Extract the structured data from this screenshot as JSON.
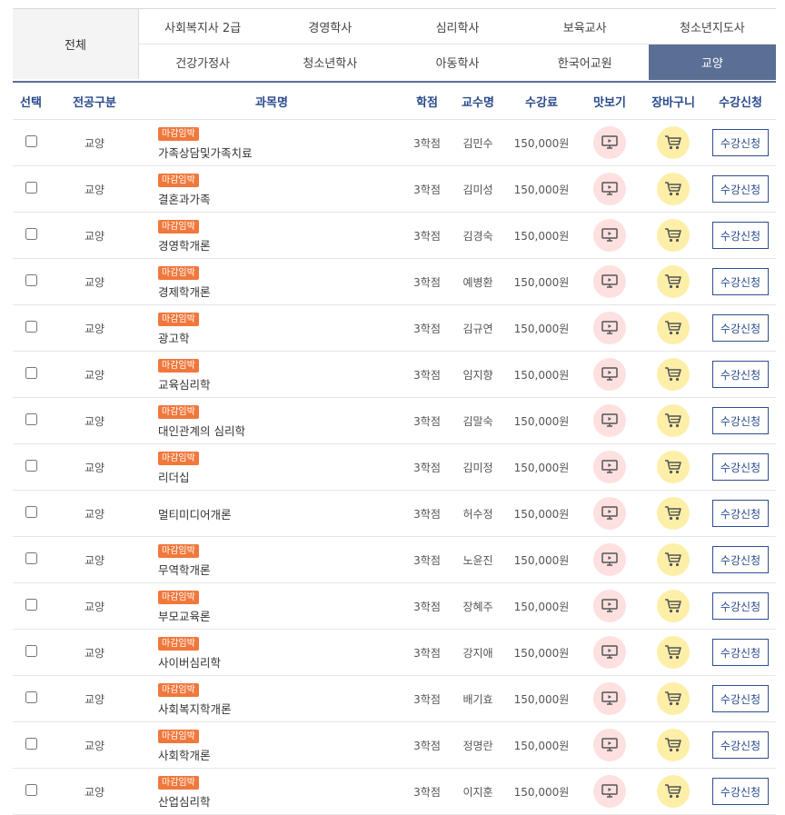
{
  "tabs": {
    "all": "전체",
    "row1": [
      "사회복지사 2급",
      "경영학사",
      "심리학사",
      "보육교사",
      "청소년지도사"
    ],
    "row2": [
      "건강가정사",
      "청소년학사",
      "아동학사",
      "한국어교원",
      "교양"
    ],
    "active": "교양"
  },
  "headers": {
    "select": "선택",
    "major": "전공구분",
    "course": "과목명",
    "credit": "학점",
    "professor": "교수명",
    "fee": "수강료",
    "preview": "맛보기",
    "cart": "장바구니",
    "apply": "수강신청"
  },
  "icons": {
    "preview": "monitor-icon",
    "cart": "cart-icon"
  },
  "colors": {
    "accent": "#5a6f94",
    "badge": "#f0783c",
    "preview_bg": "#fde0df",
    "cart_bg": "#fdefa8"
  },
  "rows": [
    {
      "major": "교양",
      "badge": "마감임박",
      "title": "가족상담및가족치료",
      "credit": "3학점",
      "professor": "김민수",
      "fee": "150,000원",
      "apply": "수강신청"
    },
    {
      "major": "교양",
      "badge": "마감임박",
      "title": "결혼과가족",
      "credit": "3학점",
      "professor": "김미성",
      "fee": "150,000원",
      "apply": "수강신청"
    },
    {
      "major": "교양",
      "badge": "마감임박",
      "title": "경영학개론",
      "credit": "3학점",
      "professor": "김경숙",
      "fee": "150,000원",
      "apply": "수강신청"
    },
    {
      "major": "교양",
      "badge": "마감임박",
      "title": "경제학개론",
      "credit": "3학점",
      "professor": "예병환",
      "fee": "150,000원",
      "apply": "수강신청"
    },
    {
      "major": "교양",
      "badge": "마감임박",
      "title": "광고학",
      "credit": "3학점",
      "professor": "김규연",
      "fee": "150,000원",
      "apply": "수강신청"
    },
    {
      "major": "교양",
      "badge": "마감임박",
      "title": "교육심리학",
      "credit": "3학점",
      "professor": "임지향",
      "fee": "150,000원",
      "apply": "수강신청"
    },
    {
      "major": "교양",
      "badge": "마감임박",
      "title": "대인관계의 심리학",
      "credit": "3학점",
      "professor": "김말숙",
      "fee": "150,000원",
      "apply": "수강신청"
    },
    {
      "major": "교양",
      "badge": "마감임박",
      "title": "리더십",
      "credit": "3학점",
      "professor": "김미정",
      "fee": "150,000원",
      "apply": "수강신청"
    },
    {
      "major": "교양",
      "badge": "",
      "title": "멀티미디어개론",
      "credit": "3학점",
      "professor": "허수정",
      "fee": "150,000원",
      "apply": "수강신청"
    },
    {
      "major": "교양",
      "badge": "마감임박",
      "title": "무역학개론",
      "credit": "3학점",
      "professor": "노윤진",
      "fee": "150,000원",
      "apply": "수강신청"
    },
    {
      "major": "교양",
      "badge": "마감임박",
      "title": "부모교육론",
      "credit": "3학점",
      "professor": "장혜주",
      "fee": "150,000원",
      "apply": "수강신청"
    },
    {
      "major": "교양",
      "badge": "마감임박",
      "title": "사이버심리학",
      "credit": "3학점",
      "professor": "강지애",
      "fee": "150,000원",
      "apply": "수강신청"
    },
    {
      "major": "교양",
      "badge": "마감임박",
      "title": "사회복지학개론",
      "credit": "3학점",
      "professor": "배기효",
      "fee": "150,000원",
      "apply": "수강신청"
    },
    {
      "major": "교양",
      "badge": "마감임박",
      "title": "사회학개론",
      "credit": "3학점",
      "professor": "정명란",
      "fee": "150,000원",
      "apply": "수강신청"
    },
    {
      "major": "교양",
      "badge": "마감임박",
      "title": "산업심리학",
      "credit": "3학점",
      "professor": "이지훈",
      "fee": "150,000원",
      "apply": "수강신청"
    }
  ]
}
